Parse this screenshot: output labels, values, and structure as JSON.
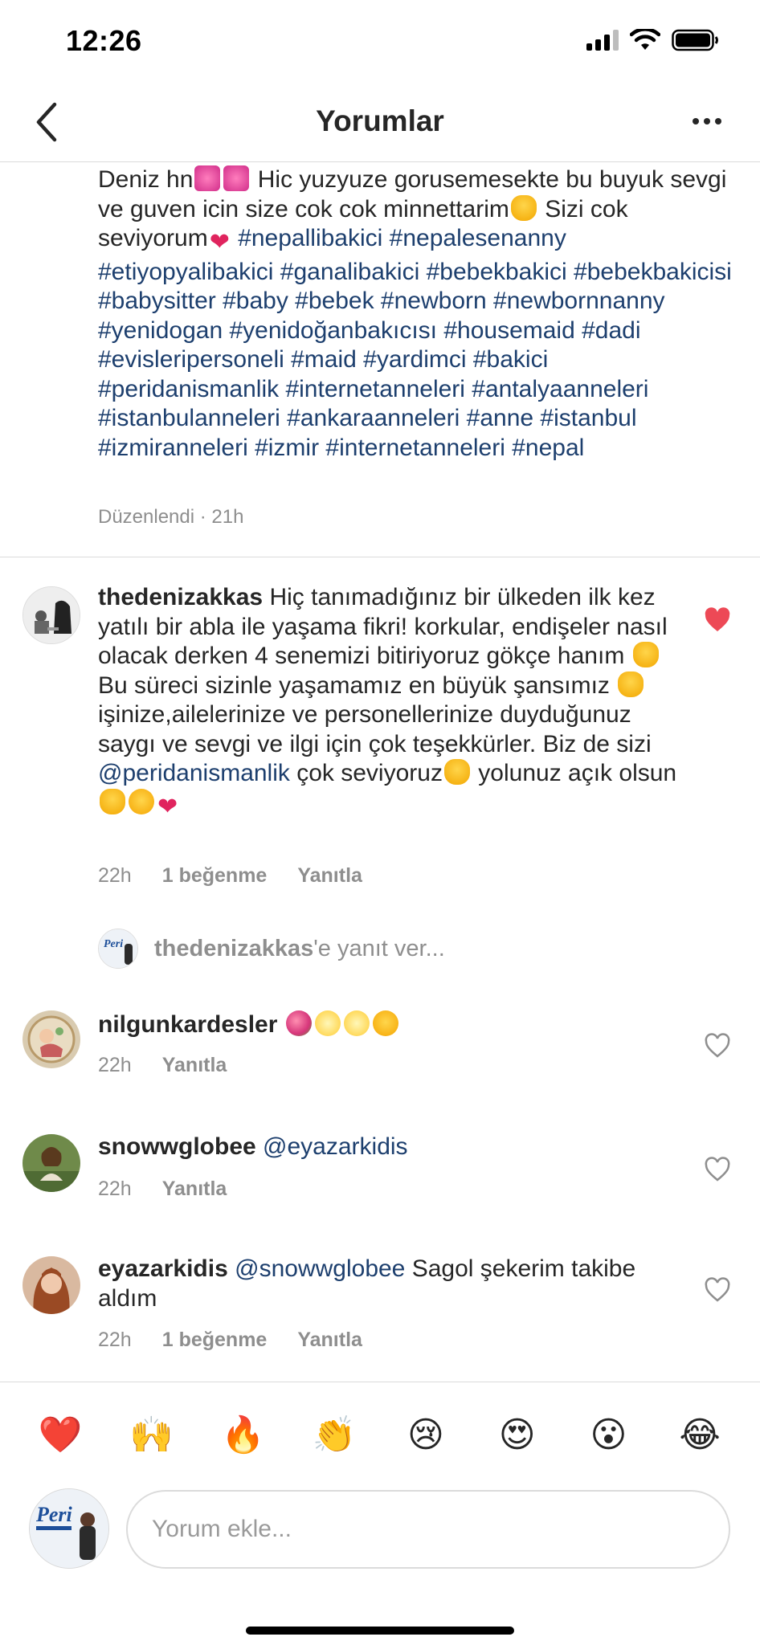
{
  "status_bar": {
    "time": "12:26"
  },
  "header": {
    "title": "Yorumlar",
    "back_icon": "chevron-left-icon",
    "more_icon": "ellipsis-icon"
  },
  "caption": {
    "line1_text": "Deniz hn",
    "line1_text_b": " Hic yuzyuze gorusemesekte bu buyuk sevgi ve guven icin size cok cok minnettarim",
    "line1_text_c": " Sizi cok seviyorum",
    "hashtags": "#nepallibakici #nepalesenanny #etiyopyalibakici #ganalibakici #bebekbakici #bebekbakicisi #babysitter #baby #bebek #newborn #newbornnanny #yenidogan #yenidoğanbakıcısı #housemaid #dadi #evisleripersoneli #maid #yardimci #bakici #peridanismanlik #internetanneleri #antalyaanneleri #istanbulanneleri #ankaraanneleri #anne #istanbul #izmiranneleri #izmir #internetanneleri #nepal",
    "meta": "Düzenlendi · 21h"
  },
  "comments": [
    {
      "username": "thedenizakkas",
      "text_a": "Hiç tanımadığınız bir ülkeden ilk kez yatılı bir abla ile yaşama fikri! korkular, endişeler nasıl olacak derken 4 senemizi bitiriyoruz gökçe hanım",
      "text_b": " Bu süreci sizinle yaşamamız en büyük şansımız",
      "text_c": " işinize,ailelerinize ve personellerinize duyduğunuz saygı ve sevgi ve ilgi için çok teşekkürler. Biz de sizi ",
      "mention": "@peridanismanlik",
      "text_d": " çok seviyoruz",
      "text_e": " yolunuz açık olsun",
      "time": "22h",
      "likes": "1 beğenme",
      "reply": "Yanıtla",
      "liked": true
    },
    {
      "username": "nilgunkardesler",
      "time": "22h",
      "reply": "Yanıtla",
      "liked": false
    },
    {
      "username": "snowwglobee",
      "mention": "@eyazarkidis",
      "time": "22h",
      "reply": "Yanıtla",
      "liked": false
    },
    {
      "username": "eyazarkidis",
      "mention": "@snowwglobee",
      "text": " Sagol şekerim takibe aldım",
      "time": "22h",
      "likes": "1 beğenme",
      "reply": "Yanıtla",
      "liked": false
    }
  ],
  "reply_prompt": {
    "username": "thedenizakkas",
    "suffix": "'e yanıt ver..."
  },
  "quick_emojis": [
    "❤️",
    "🙌",
    "🔥",
    "👏",
    "😢",
    "😍",
    "😮",
    "😂"
  ],
  "composer": {
    "placeholder": "Yorum ekle..."
  },
  "colors": {
    "link": "#1d3f6e",
    "meta": "#8e8e8e",
    "liked_heart": "#ed4956"
  }
}
